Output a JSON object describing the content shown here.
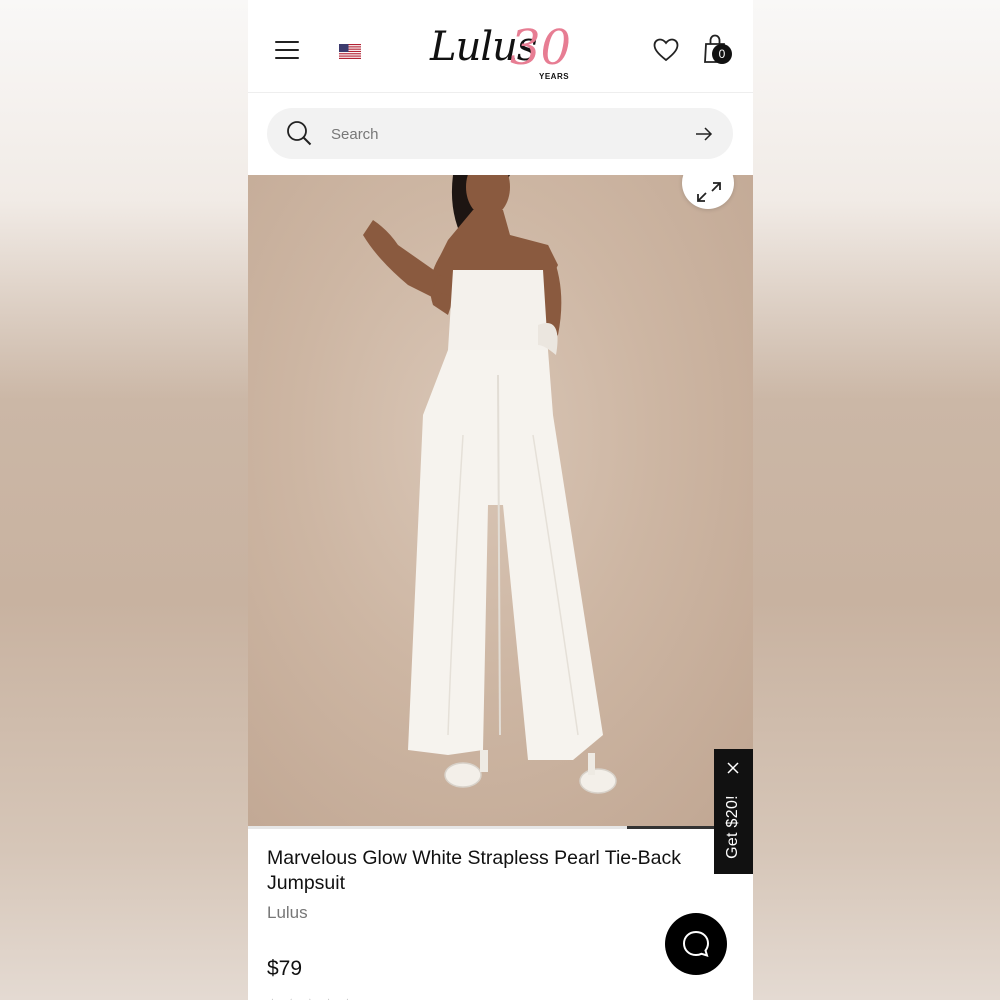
{
  "header": {
    "menu_icon": "hamburger-menu-icon",
    "flag_icon": "us-flag-icon",
    "logo": {
      "script": "Lulus",
      "anniversary": "30",
      "years": "YEARS",
      "accent_color": "#e77d93"
    },
    "wishlist_icon": "heart-icon",
    "cart_icon": "shopping-bag-icon",
    "cart_count": "0"
  },
  "search": {
    "placeholder": "Search",
    "search_icon": "search-icon",
    "submit_icon": "arrow-right-icon"
  },
  "gallery": {
    "expand_icon": "expand-icon",
    "progress_fraction": 0.25
  },
  "promo": {
    "label": "Get $20!",
    "close_icon": "close-icon"
  },
  "product": {
    "title": "Marvelous Glow White Strapless Pearl Tie-Back Jumpsuit",
    "brand": "Lulus",
    "price": "$79"
  },
  "chat": {
    "icon": "chat-bubble-icon"
  }
}
